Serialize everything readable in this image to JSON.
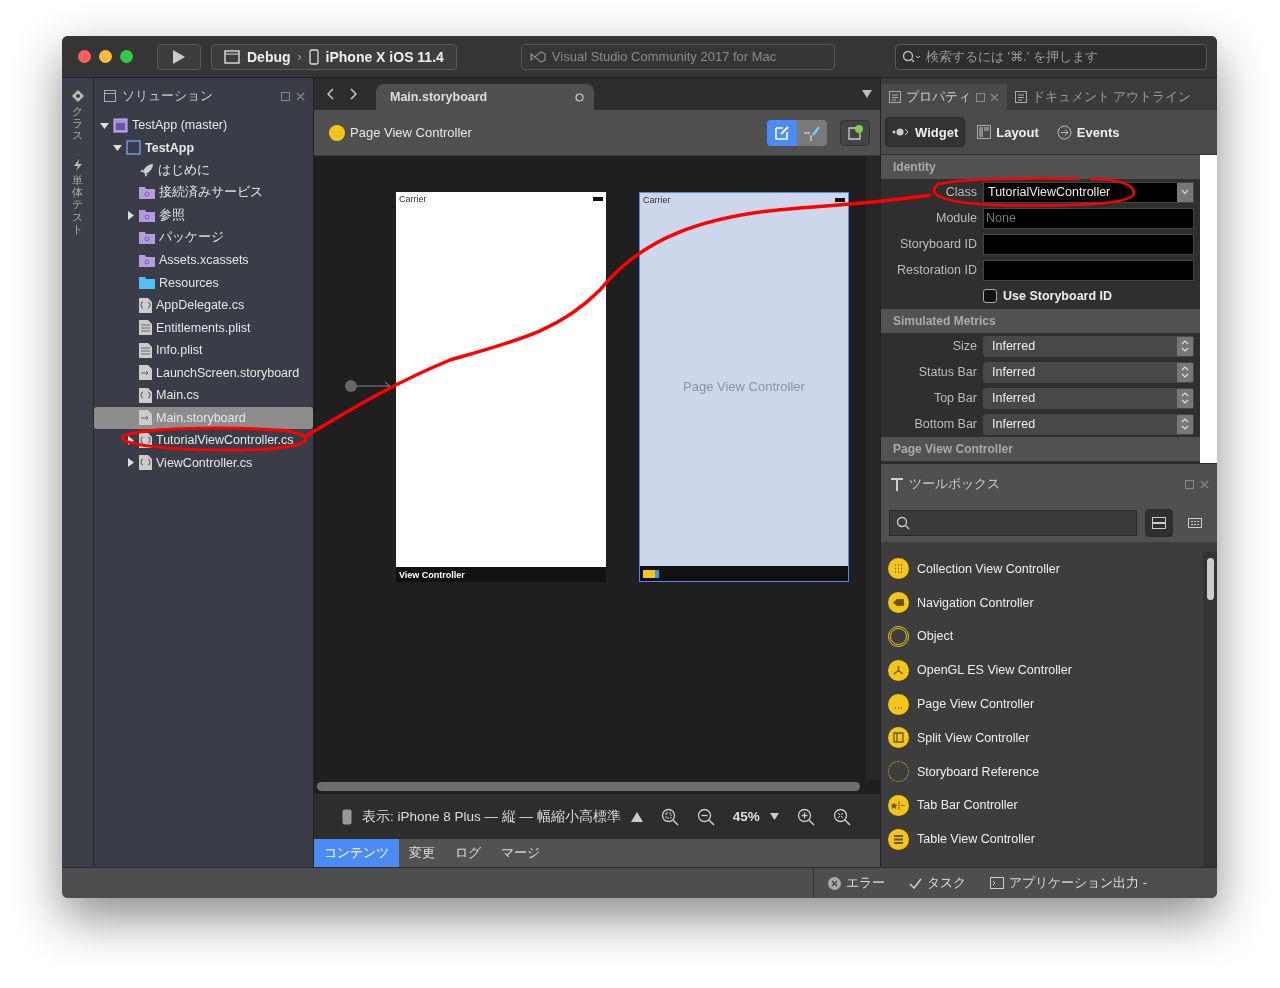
{
  "window": {
    "title": "Visual Studio Community 2017 for Mac",
    "configuration": "Debug",
    "separator": "›",
    "device": "iPhone X iOS 11.4",
    "search": {
      "placeholder": "検索するには '⌘.' を押します"
    }
  },
  "side_strip": [
    {
      "label": "クラス",
      "kind": "class"
    },
    {
      "label": "単体テスト",
      "kind": "test"
    }
  ],
  "solution": {
    "title": "ソリューション",
    "tree": [
      {
        "label": "TestApp (master)",
        "kind": "solution",
        "selected": false,
        "expanded": true,
        "children": [
          {
            "label": "TestApp",
            "kind": "project",
            "selected": false,
            "expanded": true,
            "children": [
              {
                "label": "はじめに",
                "kind": "rocket",
                "selected": false
              },
              {
                "label": "接続済みサービス",
                "kind": "special-folder",
                "selected": false
              },
              {
                "label": "参照",
                "kind": "special-folder",
                "selected": false,
                "expanded": false
              },
              {
                "label": "パッケージ",
                "kind": "special-folder",
                "selected": false
              },
              {
                "label": "Assets.xcassets",
                "kind": "special-folder",
                "selected": false
              },
              {
                "label": "Resources",
                "kind": "folder",
                "selected": false
              },
              {
                "label": "AppDelegate.cs",
                "kind": "code",
                "selected": false
              },
              {
                "label": "Entitlements.plist",
                "kind": "plist",
                "selected": false
              },
              {
                "label": "Info.plist",
                "kind": "plist",
                "selected": false
              },
              {
                "label": "LaunchScreen.storyboard",
                "kind": "storyboard",
                "selected": false
              },
              {
                "label": "Main.cs",
                "kind": "code",
                "selected": false
              },
              {
                "label": "Main.storyboard",
                "kind": "storyboard",
                "selected": true
              },
              {
                "label": "TutorialViewController.cs",
                "kind": "code",
                "selected": false,
                "expanded": false
              },
              {
                "label": "ViewController.cs",
                "kind": "code",
                "selected": false,
                "expanded": false
              }
            ]
          }
        ]
      }
    ]
  },
  "editor": {
    "tab": {
      "label": "Main.storyboard"
    },
    "object": {
      "label": "Page View Controller"
    },
    "modes": [
      {
        "kind": "design",
        "selected": true
      },
      {
        "kind": "constraints",
        "selected": false
      }
    ],
    "scenes": [
      {
        "kind": "view-controller",
        "status": "Carrier",
        "footer": "View Controller",
        "selected": false
      },
      {
        "kind": "page-view-controller",
        "status": "Carrier",
        "center": "Page View Controller",
        "selected": true
      }
    ],
    "view_as": "表示: iPhone 8 Plus — 縦 — 幅縮小高標準",
    "zoom": "45%",
    "bottom_tabs": [
      {
        "label": "コンテンツ",
        "selected": true
      },
      {
        "label": "変更",
        "selected": false
      },
      {
        "label": "ログ",
        "selected": false
      },
      {
        "label": "マージ",
        "selected": false
      }
    ]
  },
  "properties": {
    "tabs": [
      {
        "label": "プロパティ",
        "selected": true
      },
      {
        "label": "ドキュメント アウトライン",
        "selected": false
      }
    ],
    "modes": [
      {
        "label": "Widget",
        "kind": "widget",
        "selected": true
      },
      {
        "label": "Layout",
        "kind": "layout",
        "selected": false
      },
      {
        "label": "Events",
        "kind": "events",
        "selected": false
      }
    ],
    "sections": [
      {
        "title": "Identity",
        "rows": [
          {
            "kind": "combo",
            "label": "Class",
            "value": "TutorialViewController"
          },
          {
            "kind": "text",
            "label": "Module",
            "placeholder": "None"
          },
          {
            "kind": "text",
            "label": "Storyboard ID"
          },
          {
            "kind": "text",
            "label": "Restoration ID"
          },
          {
            "kind": "checkbox",
            "label": "Use Storyboard ID",
            "checked": false
          }
        ]
      },
      {
        "title": "Simulated Metrics",
        "rows": [
          {
            "kind": "select",
            "label": "Size",
            "value": "Inferred"
          },
          {
            "kind": "select",
            "label": "Status Bar",
            "value": "Inferred"
          },
          {
            "kind": "select",
            "label": "Top Bar",
            "value": "Inferred"
          },
          {
            "kind": "select",
            "label": "Bottom Bar",
            "value": "Inferred"
          }
        ]
      },
      {
        "title": "Page View Controller"
      }
    ]
  },
  "toolbox": {
    "title": "ツールボックス",
    "views": [
      {
        "kind": "list",
        "selected": true
      },
      {
        "kind": "grid",
        "selected": false
      }
    ],
    "items": [
      {
        "label": "Collection View Controller",
        "kind": "collection"
      },
      {
        "label": "Navigation Controller",
        "kind": "navigation"
      },
      {
        "label": "Object",
        "kind": "object"
      },
      {
        "label": "OpenGL ES View Controller",
        "kind": "opengl"
      },
      {
        "label": "Page View Controller",
        "kind": "page"
      },
      {
        "label": "Split View Controller",
        "kind": "split"
      },
      {
        "label": "Storyboard Reference",
        "kind": "reference"
      },
      {
        "label": "Tab Bar Controller",
        "kind": "tabbar"
      },
      {
        "label": "Table View Controller",
        "kind": "table"
      }
    ]
  },
  "status_bar": [
    {
      "label": "エラー",
      "kind": "error"
    },
    {
      "label": "タスク",
      "kind": "tasks"
    },
    {
      "label": "アプリケーション出力 -",
      "kind": "output"
    }
  ]
}
